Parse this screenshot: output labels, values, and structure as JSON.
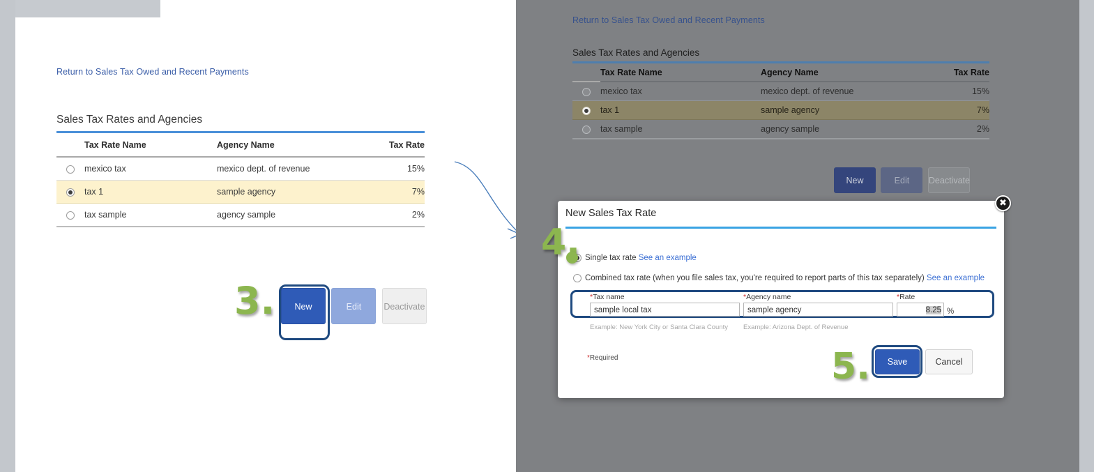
{
  "left_screen": {
    "return_link": "Return to Sales Tax Owed and Recent Payments",
    "section_title": "Sales Tax Rates and Agencies",
    "table": {
      "columns": [
        "Tax Rate Name",
        "Agency Name",
        "Tax Rate"
      ],
      "rows": [
        {
          "selected": false,
          "name": "mexico tax",
          "agency": "mexico dept. of revenue",
          "rate": "15%"
        },
        {
          "selected": true,
          "name": "tax 1",
          "agency": "sample agency",
          "rate": "7%"
        },
        {
          "selected": false,
          "name": "tax sample",
          "agency": "agency sample",
          "rate": "2%"
        }
      ]
    },
    "buttons": {
      "new": "New",
      "edit": "Edit",
      "deactivate": "Deactivate"
    }
  },
  "right_screen": {
    "return_link": "Return to Sales Tax Owed and Recent Payments",
    "section_title": "Sales Tax Rates and Agencies",
    "table": {
      "columns": [
        "Tax Rate Name",
        "Agency Name",
        "Tax Rate"
      ],
      "rows": [
        {
          "selected": false,
          "name": "mexico tax",
          "agency": "mexico dept. of revenue",
          "rate": "15%"
        },
        {
          "selected": true,
          "name": "tax 1",
          "agency": "sample agency",
          "rate": "7%"
        },
        {
          "selected": false,
          "name": "tax sample",
          "agency": "agency sample",
          "rate": "2%"
        }
      ]
    },
    "buttons": {
      "new": "New",
      "edit": "Edit",
      "deactivate": "Deactivate"
    }
  },
  "dialog": {
    "title": "New Sales Tax Rate",
    "close_icon": "close-icon",
    "options": {
      "single": {
        "label": "Single tax rate",
        "link": "See an example",
        "selected": true
      },
      "combined": {
        "label": "Combined tax rate (when you file sales tax, you're required to report parts of this tax separately)",
        "link": "See an example",
        "selected": false
      }
    },
    "fields": {
      "tax_name": {
        "label": "Tax name",
        "required_mark": "*",
        "value": "sample local tax",
        "hint": "Example: New York City or Santa Clara County"
      },
      "agency_name": {
        "label": "Agency name",
        "required_mark": "*",
        "value": "sample agency",
        "hint": "Example: Arizona Dept. of Revenue"
      },
      "rate": {
        "label": "Rate",
        "required_mark": "*",
        "value": "8.25",
        "suffix": "%",
        "hint": ""
      }
    },
    "required_note": {
      "mark": "*",
      "text": "Required"
    },
    "buttons": {
      "save": "Save",
      "cancel": "Cancel"
    }
  },
  "annotations": {
    "steps": [
      {
        "id": "step-3",
        "label": "3."
      },
      {
        "id": "step-4",
        "label": "4."
      },
      {
        "id": "step-5",
        "label": "5."
      }
    ],
    "arrow": "curved-arrow-icon"
  },
  "colors": {
    "accent_blue": "#2f5bb7",
    "rule_blue": "#4a90d9",
    "dialog_rule_blue": "#3aa3e3",
    "link_blue": "#3b5ea8",
    "step_green": "#8cb64f",
    "highlight_row": "#fdf2cd",
    "backdrop_gray": "#7f8184",
    "required_red": "#cc2b2b"
  }
}
